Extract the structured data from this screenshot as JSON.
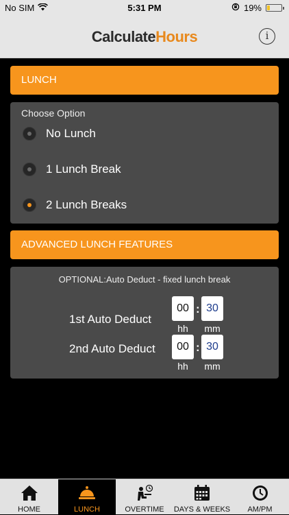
{
  "status": {
    "carrier": "No SIM",
    "time": "5:31 PM",
    "battery_text": "19%",
    "battery_level": 0.19
  },
  "header": {
    "title_part1": "Calculate",
    "title_part2": "Hours",
    "info_label": "i"
  },
  "lunch": {
    "title": "LUNCH",
    "choose_label": "Choose Option",
    "options": [
      {
        "label": "No Lunch",
        "selected": false
      },
      {
        "label": "1 Lunch Break",
        "selected": false
      },
      {
        "label": "2 Lunch Breaks",
        "selected": true
      }
    ]
  },
  "advanced": {
    "title": "ADVANCED LUNCH FEATURES",
    "note": "OPTIONAL:Auto Deduct -  fixed lunch break",
    "rows": [
      {
        "label": "1st Auto Deduct",
        "hh": "00",
        "mm": "30"
      },
      {
        "label": "2nd Auto Deduct",
        "hh": "00",
        "mm": "30"
      }
    ],
    "hh_label": "hh",
    "mm_label": "mm",
    "separator": ":"
  },
  "tabs": [
    {
      "label": "HOME",
      "icon": "home-icon",
      "active": false
    },
    {
      "label": "LUNCH",
      "icon": "cloche-icon",
      "active": true
    },
    {
      "label": "OVERTIME",
      "icon": "overtime-worker-icon",
      "active": false
    },
    {
      "label": "DAYS & WEEKS",
      "icon": "calendar-icon",
      "active": false
    },
    {
      "label": "AM/PM",
      "icon": "clock-icon",
      "active": false
    }
  ],
  "colors": {
    "accent": "#f7951d",
    "panel": "#4a4a4a",
    "background": "#000000",
    "bars": "#e6e6e6"
  }
}
